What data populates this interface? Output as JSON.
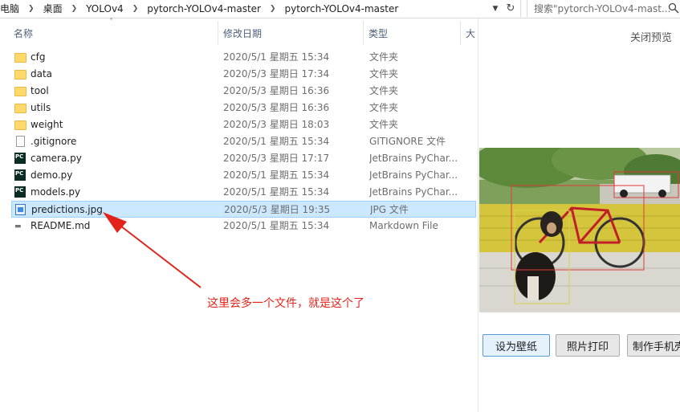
{
  "address_bar": {
    "crumbs": [
      "电脑",
      "桌面",
      "YOLOv4",
      "pytorch-YOLOv4-master",
      "pytorch-YOLOv4-master"
    ]
  },
  "search": {
    "placeholder": "搜索\"pytorch-YOLOv4-mast..."
  },
  "columns": {
    "name": "名称",
    "date": "修改日期",
    "type": "类型",
    "size": "大"
  },
  "files": [
    {
      "name": "cfg",
      "date": "2020/5/1 星期五 15:34",
      "type": "文件夹",
      "icon": "folder-icon"
    },
    {
      "name": "data",
      "date": "2020/5/3 星期日 17:34",
      "type": "文件夹",
      "icon": "folder-icon"
    },
    {
      "name": "tool",
      "date": "2020/5/3 星期日 16:36",
      "type": "文件夹",
      "icon": "folder-icon"
    },
    {
      "name": "utils",
      "date": "2020/5/3 星期日 16:36",
      "type": "文件夹",
      "icon": "folder-icon"
    },
    {
      "name": "weight",
      "date": "2020/5/3 星期日 18:03",
      "type": "文件夹",
      "icon": "folder-icon"
    },
    {
      "name": ".gitignore",
      "date": "2020/5/1 星期五 15:34",
      "type": "GITIGNORE 文件",
      "icon": "document-icon"
    },
    {
      "name": "camera.py",
      "date": "2020/5/3 星期日 17:17",
      "type": "JetBrains PyChar...",
      "icon": "pycharm-icon"
    },
    {
      "name": "demo.py",
      "date": "2020/5/1 星期五 15:34",
      "type": "JetBrains PyChar...",
      "icon": "pycharm-icon"
    },
    {
      "name": "models.py",
      "date": "2020/5/1 星期五 15:34",
      "type": "JetBrains PyChar...",
      "icon": "pycharm-icon"
    },
    {
      "name": "predictions.jpg",
      "date": "2020/5/3 星期日 19:35",
      "type": "JPG 文件",
      "icon": "image-icon",
      "selected": true
    },
    {
      "name": "README.md",
      "date": "2020/5/1 星期五 15:34",
      "type": "Markdown File",
      "icon": "markdown-icon"
    }
  ],
  "annotation": {
    "text": "这里会多一个文件，就是这个了",
    "color": "#e2231a"
  },
  "preview_pane": {
    "close_label": "关闭预览",
    "buttons": [
      "设为壁纸",
      "照片打印",
      "制作手机壳"
    ]
  },
  "colors": {
    "selection": "#cce8ff",
    "header_text": "#4c607a"
  }
}
